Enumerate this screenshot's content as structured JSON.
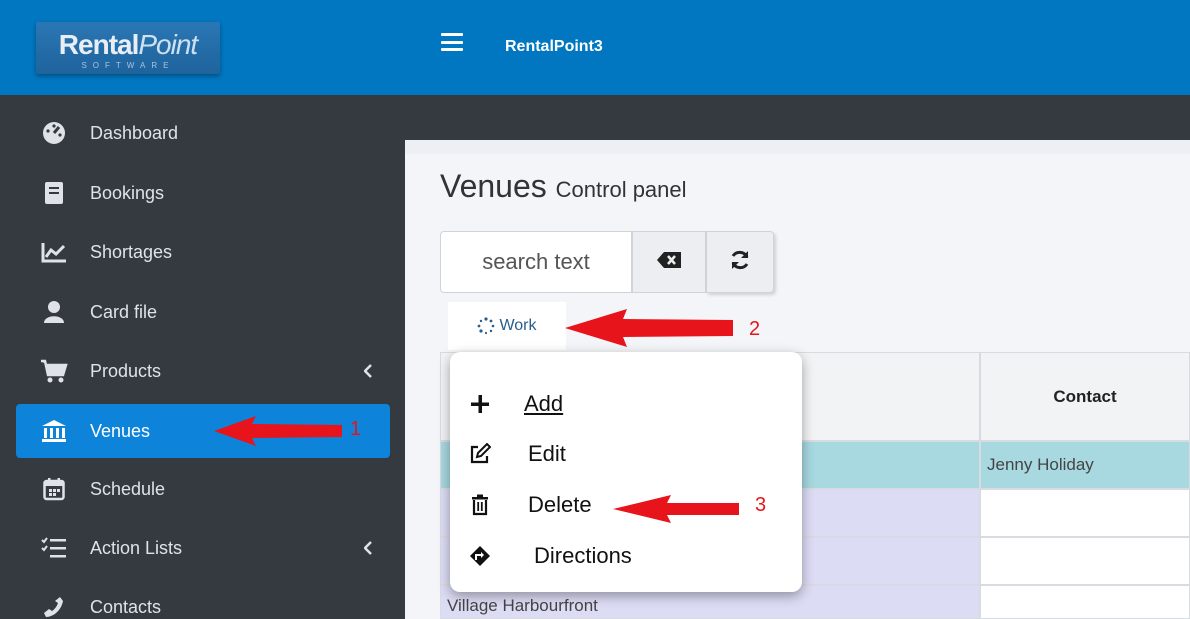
{
  "logo": {
    "rental": "Rental",
    "point": "Point",
    "software": "SOFTWARE"
  },
  "header": {
    "app_title": "RentalPoint3"
  },
  "sidebar": {
    "items": [
      {
        "label": "Dashboard",
        "icon": "dashboard-icon"
      },
      {
        "label": "Bookings",
        "icon": "book-icon"
      },
      {
        "label": "Shortages",
        "icon": "chart-line-icon"
      },
      {
        "label": "Card file",
        "icon": "user-icon"
      },
      {
        "label": "Products",
        "icon": "cart-icon",
        "expandable": true
      },
      {
        "label": "Venues",
        "icon": "bank-icon",
        "active": true
      },
      {
        "label": "Schedule",
        "icon": "calendar-icon"
      },
      {
        "label": "Action Lists",
        "icon": "tasks-icon",
        "expandable": true
      },
      {
        "label": "Contacts",
        "icon": "phone-icon"
      }
    ]
  },
  "page": {
    "title": "Venues",
    "subtitle": "Control panel"
  },
  "search": {
    "placeholder": "search text"
  },
  "work": {
    "label": "Work"
  },
  "table": {
    "headers": [
      "Contact"
    ],
    "rows": [
      {
        "name": "",
        "contact": "Jenny Holiday"
      },
      {
        "name": "",
        "contact": ""
      },
      {
        "name": "",
        "contact": ""
      },
      {
        "name": "Village Harbourfront",
        "contact": ""
      }
    ]
  },
  "menu": {
    "items": [
      {
        "label": "Add",
        "icon": "plus-icon"
      },
      {
        "label": "Edit",
        "icon": "edit-icon"
      },
      {
        "label": "Delete",
        "icon": "trash-icon"
      },
      {
        "label": "Directions",
        "icon": "directions-icon"
      }
    ]
  },
  "annotations": [
    "1",
    "2",
    "3"
  ],
  "colors": {
    "brand_blue": "#0077c0",
    "sidebar_dark": "#343a40",
    "active_item": "#0d84d9",
    "highlight_row": "#a8d8e0",
    "lavender_row": "#dcdcf5",
    "arrow_red": "#e8141b"
  }
}
